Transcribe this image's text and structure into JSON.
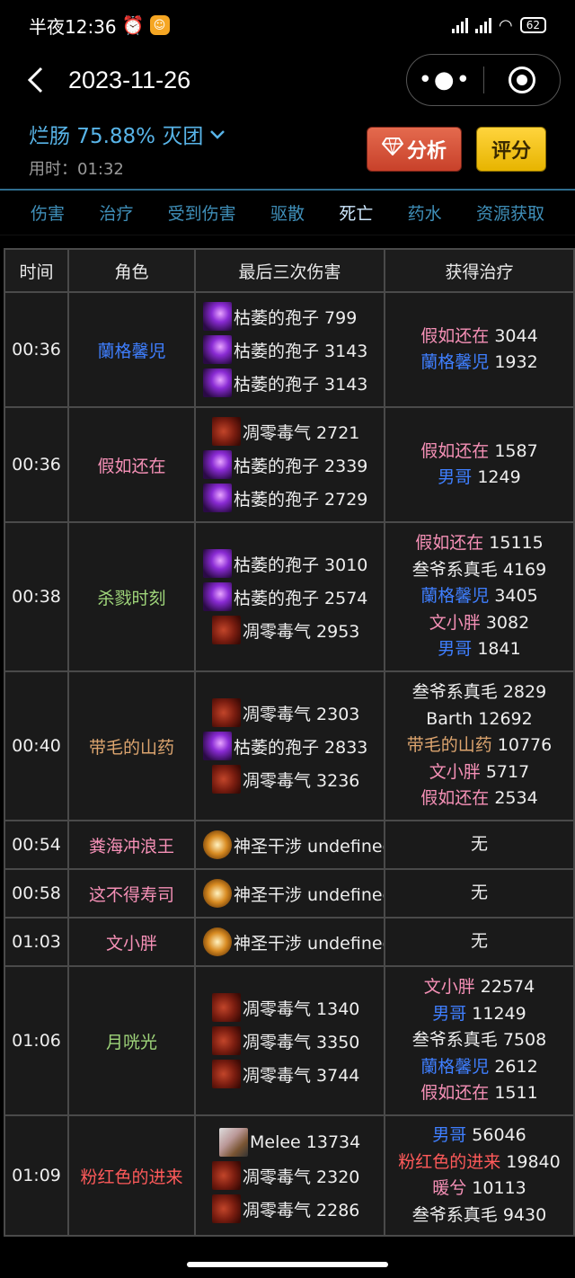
{
  "status_bar": {
    "time": "半夜12:36",
    "alarm_icon": "alarm-clock-icon",
    "battery": "62"
  },
  "nav": {
    "title": "2023-11-26"
  },
  "fight": {
    "title": "烂肠 75.88% 灭团",
    "time_label": "用时：",
    "time_value": "01:32",
    "analyze_label": "分析",
    "rate_label": "评分"
  },
  "tabs": [
    "伤害",
    "治疗",
    "受到伤害",
    "驱散",
    "死亡",
    "药水",
    "资源获取"
  ],
  "active_tab": "死亡",
  "table": {
    "headers": [
      "时间",
      "角色",
      "最后三次伤害",
      "获得治疗"
    ],
    "rows": [
      {
        "time": "00:36",
        "role": "蘭格馨児",
        "role_color": "#3f7fff",
        "damage": [
          {
            "icon": "spore-icon",
            "text": "枯萎的孢子 799"
          },
          {
            "icon": "spore-icon",
            "text": "枯萎的孢子 3143"
          },
          {
            "icon": "spore-icon",
            "text": "枯萎的孢子 3143"
          }
        ],
        "heals": [
          {
            "name": "假如还在",
            "value": "3044",
            "color": "#f590b6"
          },
          {
            "name": "蘭格馨児",
            "value": "1932",
            "color": "#3f7fff"
          }
        ]
      },
      {
        "time": "00:36",
        "role": "假如还在",
        "role_color": "#f590b6",
        "damage": [
          {
            "icon": "poison-icon",
            "text": "凋零毒气 2721"
          },
          {
            "icon": "spore-icon",
            "text": "枯萎的孢子 2339"
          },
          {
            "icon": "spore-icon",
            "text": "枯萎的孢子 2729"
          }
        ],
        "heals": [
          {
            "name": "假如还在",
            "value": "1587",
            "color": "#f590b6"
          },
          {
            "name": "男哥",
            "value": "1249",
            "color": "#3f7fff"
          }
        ]
      },
      {
        "time": "00:38",
        "role": "杀戮时刻",
        "role_color": "#9fd57a",
        "damage": [
          {
            "icon": "spore-icon",
            "text": "枯萎的孢子 3010"
          },
          {
            "icon": "spore-icon",
            "text": "枯萎的孢子 2574"
          },
          {
            "icon": "poison-icon",
            "text": "凋零毒气 2953"
          }
        ],
        "heals": [
          {
            "name": "假如还在",
            "value": "15115",
            "color": "#f590b6"
          },
          {
            "name": "叁爷系真毛",
            "value": "4169",
            "color": "#eeeeee"
          },
          {
            "name": "蘭格馨児",
            "value": "3405",
            "color": "#3f7fff"
          },
          {
            "name": "文小胖",
            "value": "3082",
            "color": "#f590b6"
          },
          {
            "name": "男哥",
            "value": "1841",
            "color": "#3f7fff"
          }
        ]
      },
      {
        "time": "00:40",
        "role": "带毛的山药",
        "role_color": "#dda56f",
        "damage": [
          {
            "icon": "poison-icon",
            "text": "凋零毒气 2303"
          },
          {
            "icon": "spore-icon",
            "text": "枯萎的孢子 2833"
          },
          {
            "icon": "poison-icon",
            "text": "凋零毒气 3236"
          }
        ],
        "heals": [
          {
            "name": "叁爷系真毛",
            "value": "2829",
            "color": "#eeeeee"
          },
          {
            "name": "Barth",
            "value": "12692",
            "color": "#eeeeee"
          },
          {
            "name": "带毛的山药",
            "value": "10776",
            "color": "#dda56f"
          },
          {
            "name": "文小胖",
            "value": "5717",
            "color": "#f590b6"
          },
          {
            "name": "假如还在",
            "value": "2534",
            "color": "#f590b6"
          }
        ]
      },
      {
        "time": "00:54",
        "role": "粪海冲浪王",
        "role_color": "#f590b6",
        "damage": [
          {
            "icon": "holy-icon",
            "text": "神圣干涉 undefined"
          }
        ],
        "heals_none": "无"
      },
      {
        "time": "00:58",
        "role": "这不得寿司",
        "role_color": "#f590b6",
        "damage": [
          {
            "icon": "holy-icon",
            "text": "神圣干涉 undefined"
          }
        ],
        "heals_none": "无"
      },
      {
        "time": "01:03",
        "role": "文小胖",
        "role_color": "#f590b6",
        "damage": [
          {
            "icon": "holy-icon",
            "text": "神圣干涉 undefined"
          }
        ],
        "heals_none": "无"
      },
      {
        "time": "01:06",
        "role": "月咣光",
        "role_color": "#9fd57a",
        "damage": [
          {
            "icon": "poison-icon",
            "text": "凋零毒气 1340"
          },
          {
            "icon": "poison-icon",
            "text": "凋零毒气 3350"
          },
          {
            "icon": "poison-icon",
            "text": "凋零毒气 3744"
          }
        ],
        "heals": [
          {
            "name": "文小胖",
            "value": "22574",
            "color": "#f590b6"
          },
          {
            "name": "男哥",
            "value": "11249",
            "color": "#3f7fff"
          },
          {
            "name": "叁爷系真毛",
            "value": "7508",
            "color": "#eeeeee"
          },
          {
            "name": "蘭格馨児",
            "value": "2612",
            "color": "#3f7fff"
          },
          {
            "name": "假如还在",
            "value": "1511",
            "color": "#f590b6"
          }
        ]
      },
      {
        "time": "01:09",
        "role": "粉红色的进来",
        "role_color": "#ff5a5a",
        "damage": [
          {
            "icon": "melee-icon",
            "text": "Melee 13734"
          },
          {
            "icon": "poison-icon",
            "text": "凋零毒气 2320"
          },
          {
            "icon": "poison-icon",
            "text": "凋零毒气 2286"
          }
        ],
        "heals": [
          {
            "name": "男哥",
            "value": "56046",
            "color": "#3f7fff"
          },
          {
            "name": "粉红色的进来",
            "value": "19840",
            "color": "#ff5a5a"
          },
          {
            "name": "暖兮",
            "value": "10113",
            "color": "#f590b6"
          },
          {
            "name": "叁爷系真毛",
            "value": "9430",
            "color": "#eeeeee"
          }
        ]
      }
    ]
  }
}
